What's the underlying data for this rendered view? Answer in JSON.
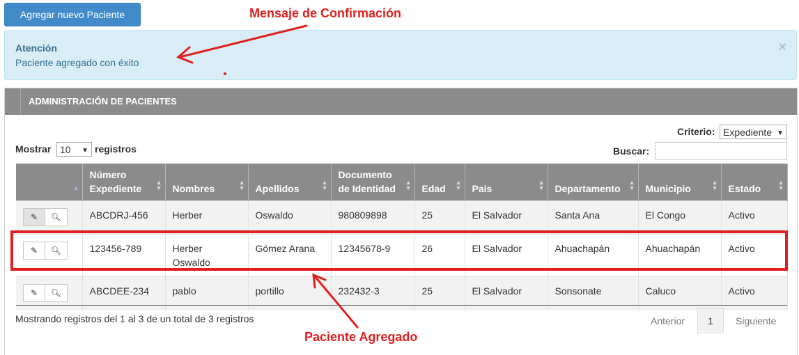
{
  "toolbar": {
    "add_patient_label": "Agregar nuevo Paciente"
  },
  "annotations": {
    "confirmation_label": "Mensaje de Confirmación",
    "added_label": "Paciente Agregado",
    "color": "#e0201f"
  },
  "alert": {
    "title": "Atención",
    "message": "Paciente agregado con éxito",
    "close_glyph": "×"
  },
  "panel": {
    "title": "ADMINISTRACIÓN DE PACIENTES"
  },
  "controls": {
    "show_label": "Mostrar",
    "show_value": "10",
    "records_label": "registros",
    "criteria_label": "Criterio:",
    "criteria_value": "Expediente",
    "search_label": "Buscar:",
    "search_value": ""
  },
  "table": {
    "headers": [
      "",
      "Número Expediente",
      "Nombres",
      "Apellidos",
      "Documento de Identidad",
      "Edad",
      "Pais",
      "Departamento",
      "Municipio",
      "Estado"
    ],
    "rows": [
      [
        "ABCDRJ-456",
        "Herber",
        "Oswaldo",
        "980809898",
        "25",
        "El Salvador",
        "Santa Ana",
        "El Congo",
        "Activo"
      ],
      [
        "123456-789",
        "Herber Oswaldo",
        "Gómez Arana",
        "12345678-9",
        "26",
        "El Salvador",
        "Ahuachapán",
        "Ahuachapán",
        "Activo"
      ],
      [
        "ABCDEE-234",
        "pablo",
        "portillo",
        "232432-3",
        "25",
        "El Salvador",
        "Sonsonate",
        "Caluco",
        "Activo"
      ]
    ],
    "row_actions": {
      "edit_icon": "edit-icon",
      "view_icon": "zoom-icon"
    }
  },
  "footer": {
    "info": "Mostrando registros del 1 al 3 de un total de 3 registros",
    "prev_label": "Anterior",
    "current_page": "1",
    "next_label": "Siguiente"
  }
}
